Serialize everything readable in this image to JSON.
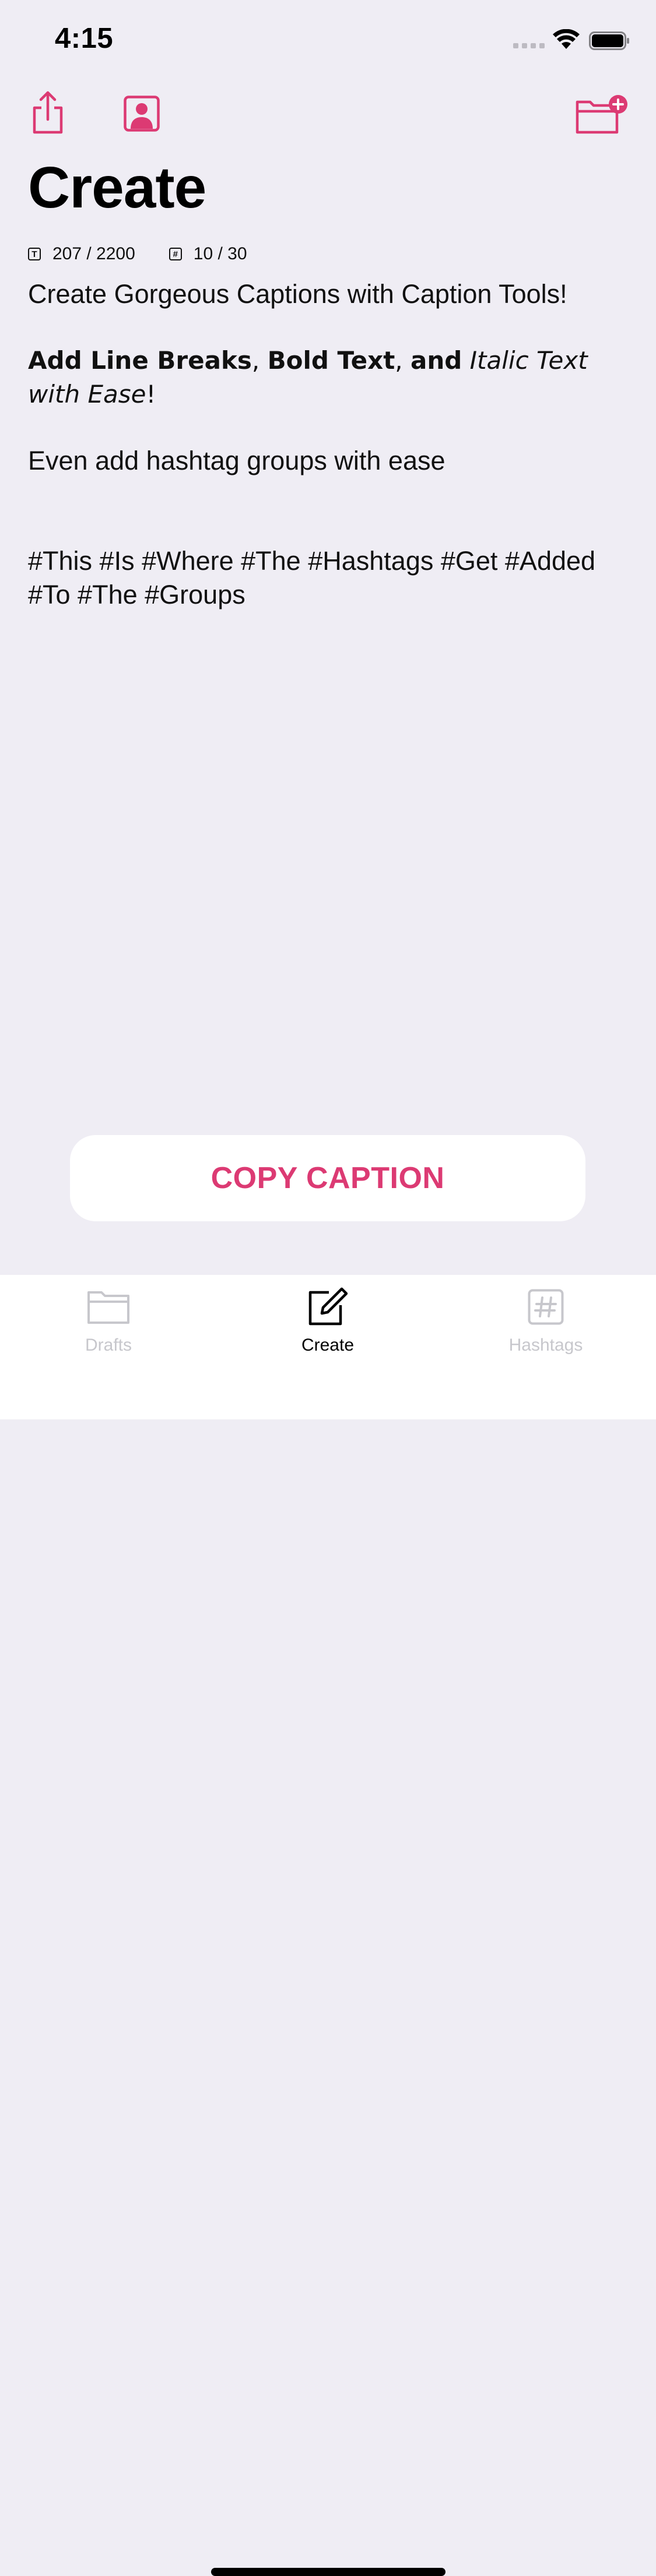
{
  "status_bar": {
    "time": "4:15"
  },
  "toolbar": {
    "share_icon": "share-icon",
    "profile_icon": "profile-icon",
    "new_folder_icon": "folder-plus-icon"
  },
  "header": {
    "title": "Create"
  },
  "counters": {
    "characters": "207 / 2200",
    "hashtags": "10 / 30"
  },
  "caption": {
    "line1": "Create Gorgeous Captions with Caption Tools!",
    "line2_bold_a": "Add Line Breaks",
    "line2_sep_a": ", ",
    "line2_bold_b": "Bold Text",
    "line2_sep_b": ", ",
    "line2_bold_c": "and",
    "line2_sep_c": " ",
    "line2_italic": "Italic Text with Ease",
    "line2_end": "!",
    "line3": "Even add hashtag groups with ease",
    "hashtags": "#This #Is #Where #The #Hashtags #Get #Added #To #The #Groups"
  },
  "actions": {
    "copy_label": "COPY CAPTION"
  },
  "tabs": [
    {
      "label": "Drafts",
      "icon": "folder-icon",
      "active": false
    },
    {
      "label": "Create",
      "icon": "compose-icon",
      "active": true
    },
    {
      "label": "Hashtags",
      "icon": "hashtag-icon",
      "active": false
    }
  ],
  "colors": {
    "accent": "#dc3a73",
    "background": "#efedf4",
    "tab_inactive": "#c7c7cc"
  }
}
